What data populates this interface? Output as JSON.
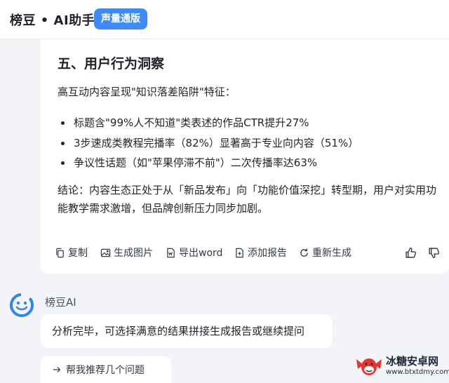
{
  "header": {
    "title": "榜豆 • AI助手",
    "badge": "声量通版"
  },
  "answer": {
    "section_title": "五、用户行为洞察",
    "intro": "高互动内容呈现\"知识落差陷阱\"特征：",
    "bullets": [
      "标题含\"99%人不知道\"类表述的作品CTR提升27%",
      "3步速成类教程完播率（82%）显著高于专业向内容（51%）",
      "争议性话题（如\"苹果停滞不前\"）二次传播率达63%"
    ],
    "conclusion": "结论：内容生态正处于从「新品发布」向「功能价值深挖」转型期，用户对实用功能教学需求激增，但品牌创新压力同步加剧。",
    "actions": {
      "copy": "复制",
      "generate_image": "生成图片",
      "export_word": "导出word",
      "add_report": "添加报告",
      "regenerate": "重新生成"
    }
  },
  "ai_message": {
    "name": "榜豆AI",
    "text": "分析完毕，可选择满意的结果拼接生成报告或继续提问",
    "suggestion": "帮我推荐几个问题"
  },
  "watermark": {
    "title": "冰糖安卓网",
    "url": "www.btxtdmy.com"
  },
  "colors": {
    "accent": "#3e8bf5",
    "background": "#f2f4f8",
    "card": "#ffffff",
    "avatar": "#2f86f0"
  }
}
